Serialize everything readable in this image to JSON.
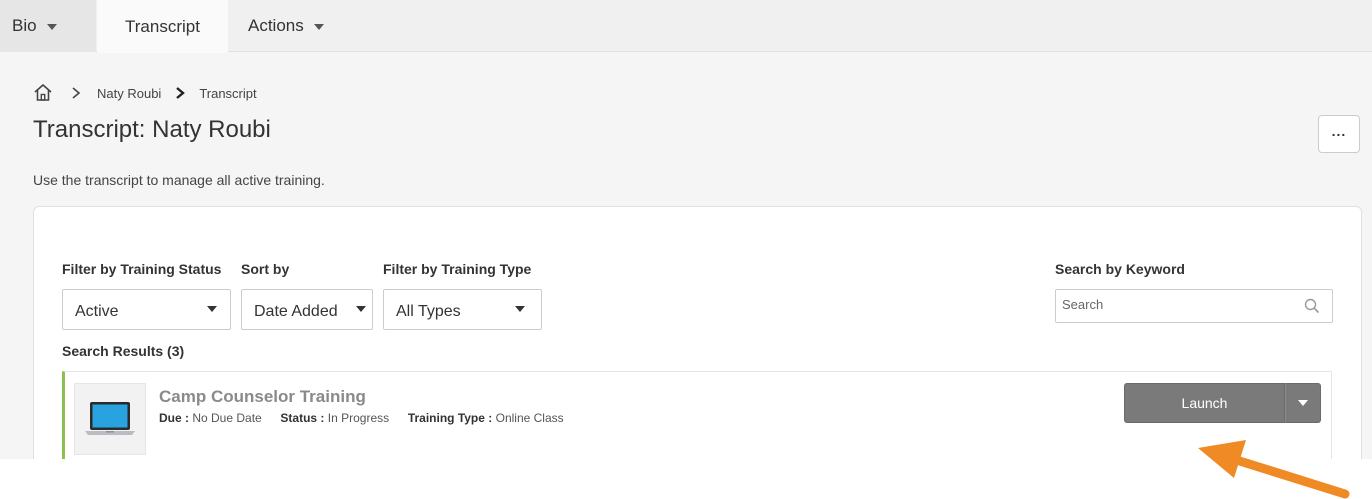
{
  "nav": {
    "tabs": [
      {
        "label": "Bio",
        "dropdown": true
      },
      {
        "label": "Transcript",
        "active": true
      },
      {
        "label": "Actions",
        "dropdown": true
      }
    ]
  },
  "breadcrumb": {
    "home_icon": "home-icon",
    "items": [
      "Naty Roubi",
      "Transcript"
    ]
  },
  "page": {
    "title": "Transcript: Naty Roubi",
    "description": "Use the transcript to manage all active training.",
    "more_label": "..."
  },
  "filters": {
    "status": {
      "label": "Filter by Training Status",
      "value": "Active"
    },
    "sort": {
      "label": "Sort by",
      "value": "Date Added"
    },
    "type": {
      "label": "Filter by Training Type",
      "value": "All Types"
    },
    "keyword": {
      "label": "Search by Keyword",
      "placeholder": "Search"
    }
  },
  "results": {
    "label": "Search Results (3)",
    "items": [
      {
        "title": "Camp Counselor Training",
        "due_label": "Due :",
        "due_value": "No Due Date",
        "status_label": "Status :",
        "status_value": "In Progress",
        "type_label": "Training Type :",
        "type_value": "Online Class",
        "action_label": "Launch",
        "accent_color": "#8cc152"
      }
    ]
  },
  "annotation": {
    "arrow_color": "#f08a24"
  }
}
